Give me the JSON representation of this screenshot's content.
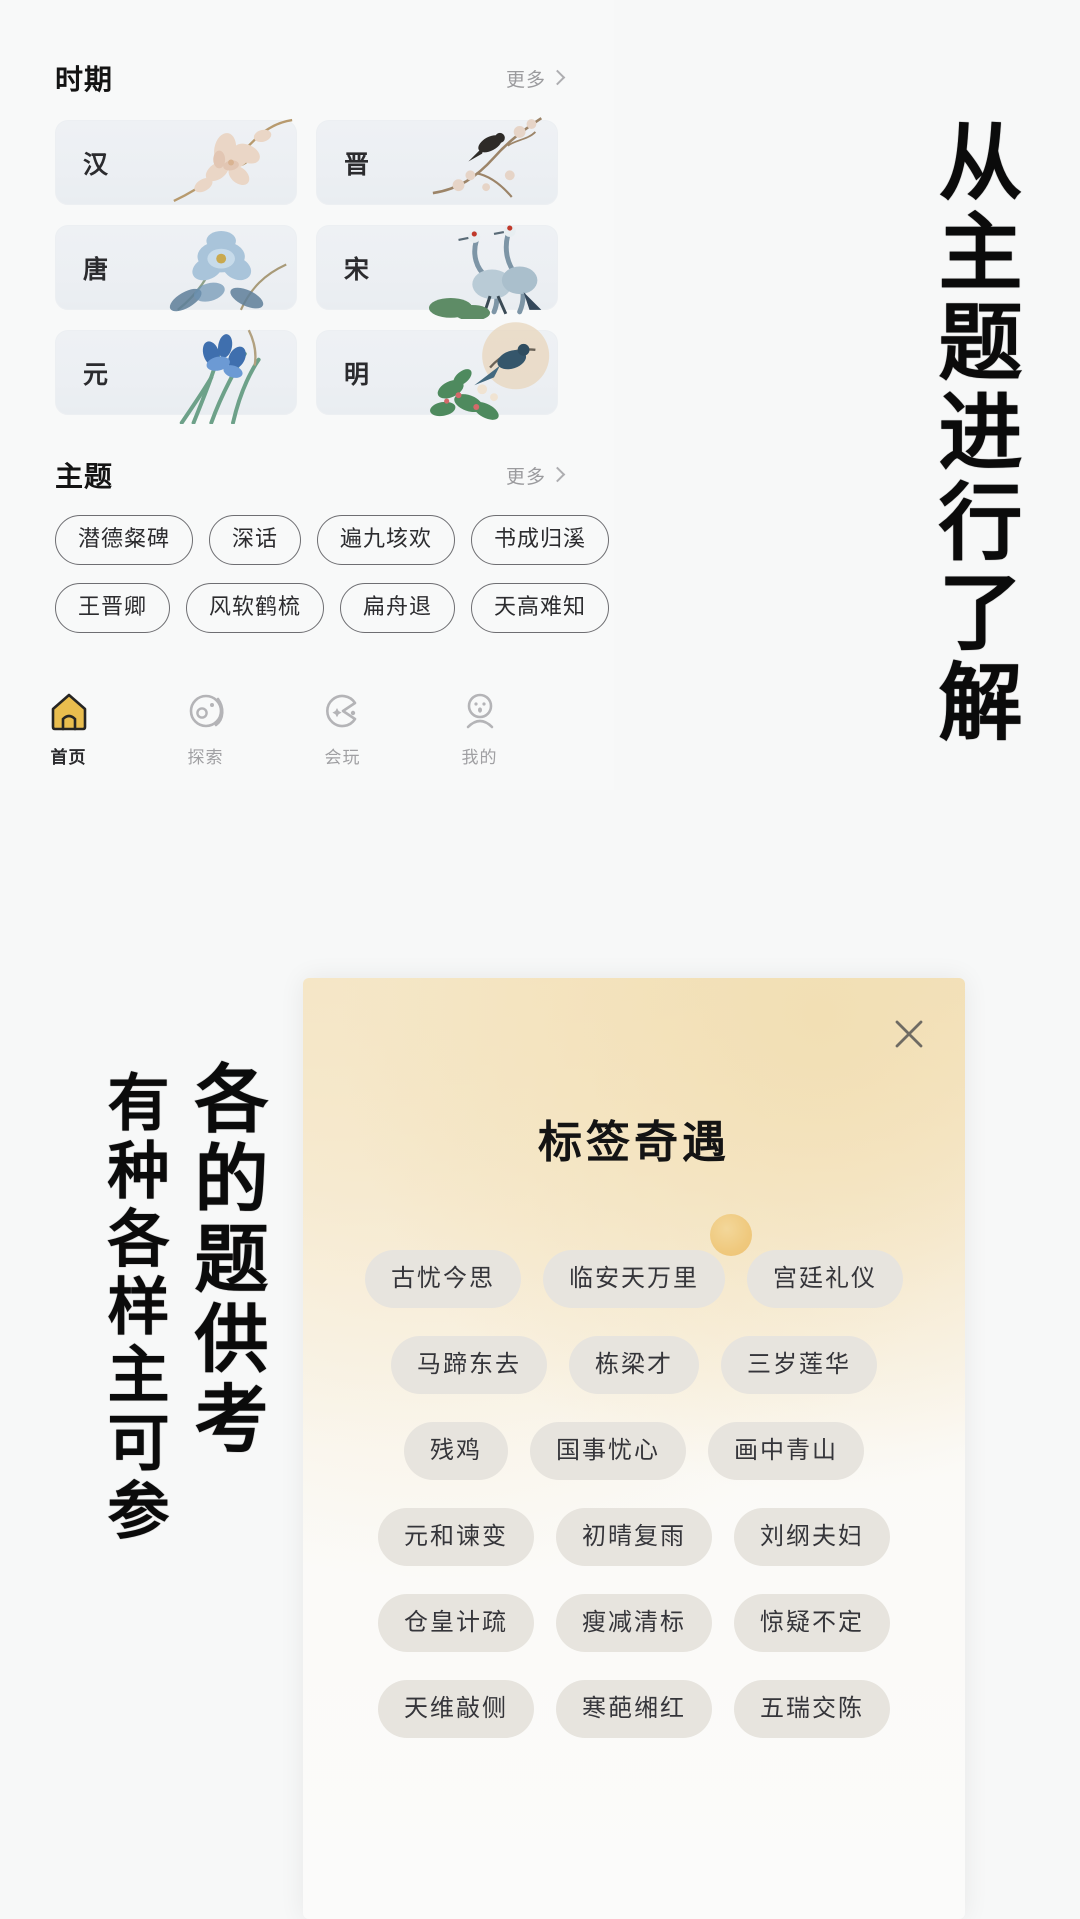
{
  "app": {
    "era_section": {
      "title": "时期",
      "more_label": "更多",
      "items": [
        {
          "label": "汉",
          "art": "magnolia-blossom-art"
        },
        {
          "label": "晋",
          "art": "plum-branch-bird-art"
        },
        {
          "label": "唐",
          "art": "blue-peony-art"
        },
        {
          "label": "宋",
          "art": "two-cranes-art"
        },
        {
          "label": "元",
          "art": "blue-iris-art"
        },
        {
          "label": "明",
          "art": "pheasant-foliage-art"
        }
      ]
    },
    "theme_section": {
      "title": "主题",
      "more_label": "更多",
      "rows": [
        [
          "潜德粲碑",
          "深话",
          "遍九垓欢",
          "书成归溪"
        ],
        [
          "王晋卿",
          "风软鹤梳",
          "扁舟退",
          "天高难知"
        ]
      ]
    },
    "tabbar": {
      "items": [
        {
          "label": "首页",
          "icon": "home-icon",
          "active": true
        },
        {
          "label": "探索",
          "icon": "compass-icon",
          "active": false
        },
        {
          "label": "会玩",
          "icon": "play-moon-icon",
          "active": false
        },
        {
          "label": "我的",
          "icon": "person-icon",
          "active": false
        }
      ],
      "active_color": "#e2b23c"
    }
  },
  "annotations": {
    "right_vertical": "从主题进行了解",
    "bottom_vertical_outer": "有种各样主可参",
    "bottom_vertical_inner": "各的题供考"
  },
  "modal": {
    "title": "标签奇遇",
    "close_icon": "close-icon",
    "tag_rows": [
      [
        "古忧今思",
        "临安天万里",
        "宫廷礼仪"
      ],
      [
        "马蹄东去",
        "栋梁才",
        "三岁莲华"
      ],
      [
        "残鸡",
        "国事忧心",
        "画中青山"
      ],
      [
        "元和谏变",
        "初晴复雨",
        "刘纲夫妇"
      ],
      [
        "仓皇计疏",
        "瘦减清标",
        "惊疑不定"
      ],
      [
        "天维敲侧",
        "寒葩缃红",
        "五瑞交陈"
      ]
    ],
    "accent_color": "#efc97e",
    "tag_bg": "#e7e4de"
  }
}
